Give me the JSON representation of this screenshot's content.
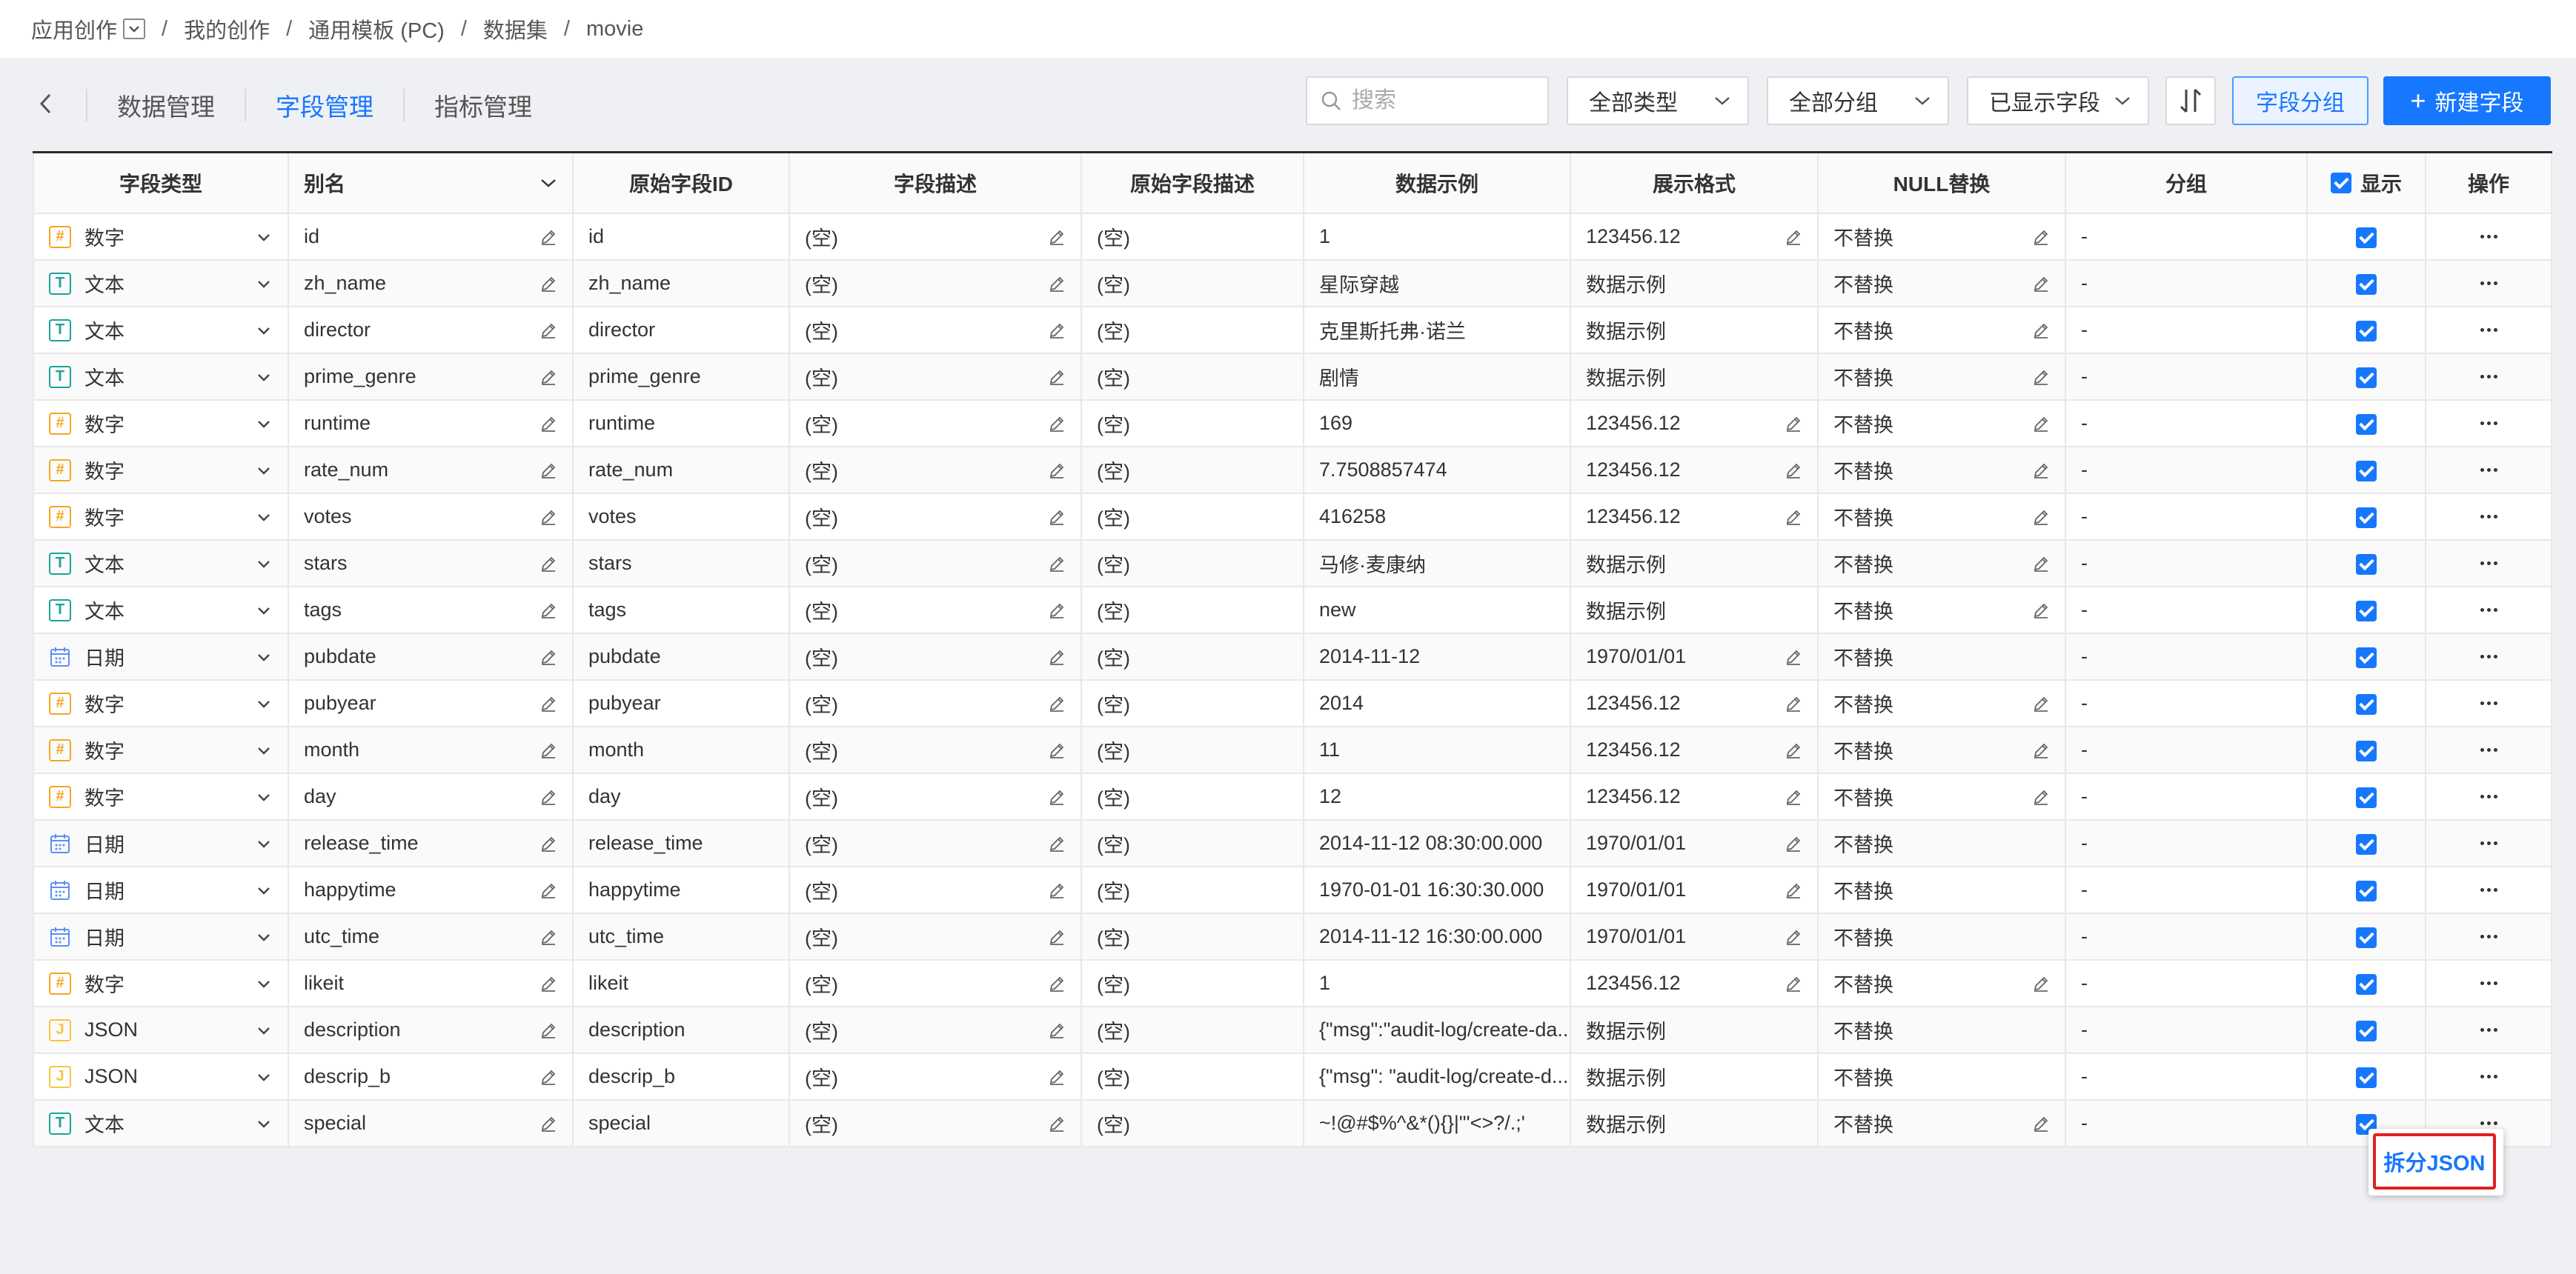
{
  "breadcrumb": {
    "items": [
      "应用创作",
      "我的创作",
      "通用模板 (PC)",
      "数据集",
      "movie"
    ],
    "separator": "/"
  },
  "tabs": {
    "back": "<",
    "items": [
      "数据管理",
      "字段管理",
      "指标管理"
    ],
    "active_index": 1
  },
  "toolbar": {
    "search_placeholder": "搜索",
    "type_filter": "全部类型",
    "group_filter": "全部分组",
    "shown_fields": "已显示字段",
    "field_group_button": "字段分组",
    "new_field_button": "新建字段",
    "new_field_plus": "+"
  },
  "table": {
    "columns": [
      "字段类型",
      "别名",
      "原始字段ID",
      "字段描述",
      "原始字段描述",
      "数据示例",
      "展示格式",
      "NULL替换",
      "分组",
      "显示",
      "操作"
    ],
    "empty_desc": "(空)",
    "rows": [
      {
        "type": "数字",
        "type_icon": "#",
        "type_key": "num",
        "alias": "id",
        "field_id": "id",
        "sample": "1",
        "format": "123456.12",
        "format_edit": true,
        "null": "不替换",
        "null_edit": true,
        "group": "-"
      },
      {
        "type": "文本",
        "type_icon": "T",
        "type_key": "text",
        "alias": "zh_name",
        "field_id": "zh_name",
        "sample": "星际穿越",
        "format": "数据示例",
        "format_edit": false,
        "null": "不替换",
        "null_edit": true,
        "group": "-"
      },
      {
        "type": "文本",
        "type_icon": "T",
        "type_key": "text",
        "alias": "director",
        "field_id": "director",
        "sample": "克里斯托弗·诺兰",
        "format": "数据示例",
        "format_edit": false,
        "null": "不替换",
        "null_edit": true,
        "group": "-"
      },
      {
        "type": "文本",
        "type_icon": "T",
        "type_key": "text",
        "alias": "prime_genre",
        "field_id": "prime_genre",
        "sample": "剧情",
        "format": "数据示例",
        "format_edit": false,
        "null": "不替换",
        "null_edit": true,
        "group": "-"
      },
      {
        "type": "数字",
        "type_icon": "#",
        "type_key": "num",
        "alias": "runtime",
        "field_id": "runtime",
        "sample": "169",
        "format": "123456.12",
        "format_edit": true,
        "null": "不替换",
        "null_edit": true,
        "group": "-"
      },
      {
        "type": "数字",
        "type_icon": "#",
        "type_key": "num",
        "alias": "rate_num",
        "field_id": "rate_num",
        "sample": "7.7508857474",
        "format": "123456.12",
        "format_edit": true,
        "null": "不替换",
        "null_edit": true,
        "group": "-"
      },
      {
        "type": "数字",
        "type_icon": "#",
        "type_key": "num",
        "alias": "votes",
        "field_id": "votes",
        "sample": "416258",
        "format": "123456.12",
        "format_edit": true,
        "null": "不替换",
        "null_edit": true,
        "group": "-"
      },
      {
        "type": "文本",
        "type_icon": "T",
        "type_key": "text",
        "alias": "stars",
        "field_id": "stars",
        "sample": "马修·麦康纳",
        "format": "数据示例",
        "format_edit": false,
        "null": "不替换",
        "null_edit": true,
        "group": "-"
      },
      {
        "type": "文本",
        "type_icon": "T",
        "type_key": "text",
        "alias": "tags",
        "field_id": "tags",
        "sample": "new",
        "format": "数据示例",
        "format_edit": false,
        "null": "不替换",
        "null_edit": true,
        "group": "-"
      },
      {
        "type": "日期",
        "type_icon": "calendar",
        "type_key": "date",
        "alias": "pubdate",
        "field_id": "pubdate",
        "sample": "2014-11-12",
        "format": "1970/01/01",
        "format_edit": true,
        "null": "不替换",
        "null_edit": false,
        "group": "-"
      },
      {
        "type": "数字",
        "type_icon": "#",
        "type_key": "num",
        "alias": "pubyear",
        "field_id": "pubyear",
        "sample": "2014",
        "format": "123456.12",
        "format_edit": true,
        "null": "不替换",
        "null_edit": true,
        "group": "-"
      },
      {
        "type": "数字",
        "type_icon": "#",
        "type_key": "num",
        "alias": "month",
        "field_id": "month",
        "sample": "11",
        "format": "123456.12",
        "format_edit": true,
        "null": "不替换",
        "null_edit": true,
        "group": "-"
      },
      {
        "type": "数字",
        "type_icon": "#",
        "type_key": "num",
        "alias": "day",
        "field_id": "day",
        "sample": "12",
        "format": "123456.12",
        "format_edit": true,
        "null": "不替换",
        "null_edit": true,
        "group": "-"
      },
      {
        "type": "日期",
        "type_icon": "calendar",
        "type_key": "date",
        "alias": "release_time",
        "field_id": "release_time",
        "sample": "2014-11-12 08:30:00.000",
        "format": "1970/01/01",
        "format_edit": true,
        "null": "不替换",
        "null_edit": false,
        "group": "-"
      },
      {
        "type": "日期",
        "type_icon": "calendar",
        "type_key": "date",
        "alias": "happytime",
        "field_id": "happytime",
        "sample": "1970-01-01 16:30:30.000",
        "format": "1970/01/01",
        "format_edit": true,
        "null": "不替换",
        "null_edit": false,
        "group": "-"
      },
      {
        "type": "日期",
        "type_icon": "calendar",
        "type_key": "date",
        "alias": "utc_time",
        "field_id": "utc_time",
        "sample": "2014-11-12 16:30:00.000",
        "format": "1970/01/01",
        "format_edit": true,
        "null": "不替换",
        "null_edit": false,
        "group": "-"
      },
      {
        "type": "数字",
        "type_icon": "#",
        "type_key": "num",
        "alias": "likeit",
        "field_id": "likeit",
        "sample": "1",
        "format": "123456.12",
        "format_edit": true,
        "null": "不替换",
        "null_edit": true,
        "group": "-"
      },
      {
        "type": "JSON",
        "type_icon": "J",
        "type_key": "json",
        "alias": "description",
        "field_id": "description",
        "sample": "{\"msg\":\"audit-log/create-da...",
        "format": "数据示例",
        "format_edit": false,
        "null": "不替换",
        "null_edit": false,
        "group": "-"
      },
      {
        "type": "JSON",
        "type_icon": "J",
        "type_key": "json",
        "alias": "descrip_b",
        "field_id": "descrip_b",
        "sample": "{\"msg\": \"audit-log/create-d...",
        "format": "数据示例",
        "format_edit": false,
        "null": "不替换",
        "null_edit": false,
        "group": "-"
      },
      {
        "type": "文本",
        "type_icon": "T",
        "type_key": "text",
        "alias": "special",
        "field_id": "special",
        "sample": "~!@#$%^&*(){}|\"'<>?/.;'",
        "format": "数据示例",
        "format_edit": false,
        "null": "不替换",
        "null_edit": true,
        "group": "-"
      }
    ]
  },
  "popup": {
    "label": "拆分JSON"
  },
  "colors": {
    "accent": "#1677ff",
    "number_icon": "#f5a623",
    "text_icon": "#1aa39a",
    "json_icon": "#f5c542",
    "date_icon": "#5b8ff9",
    "highlight_border": "#e02020"
  }
}
